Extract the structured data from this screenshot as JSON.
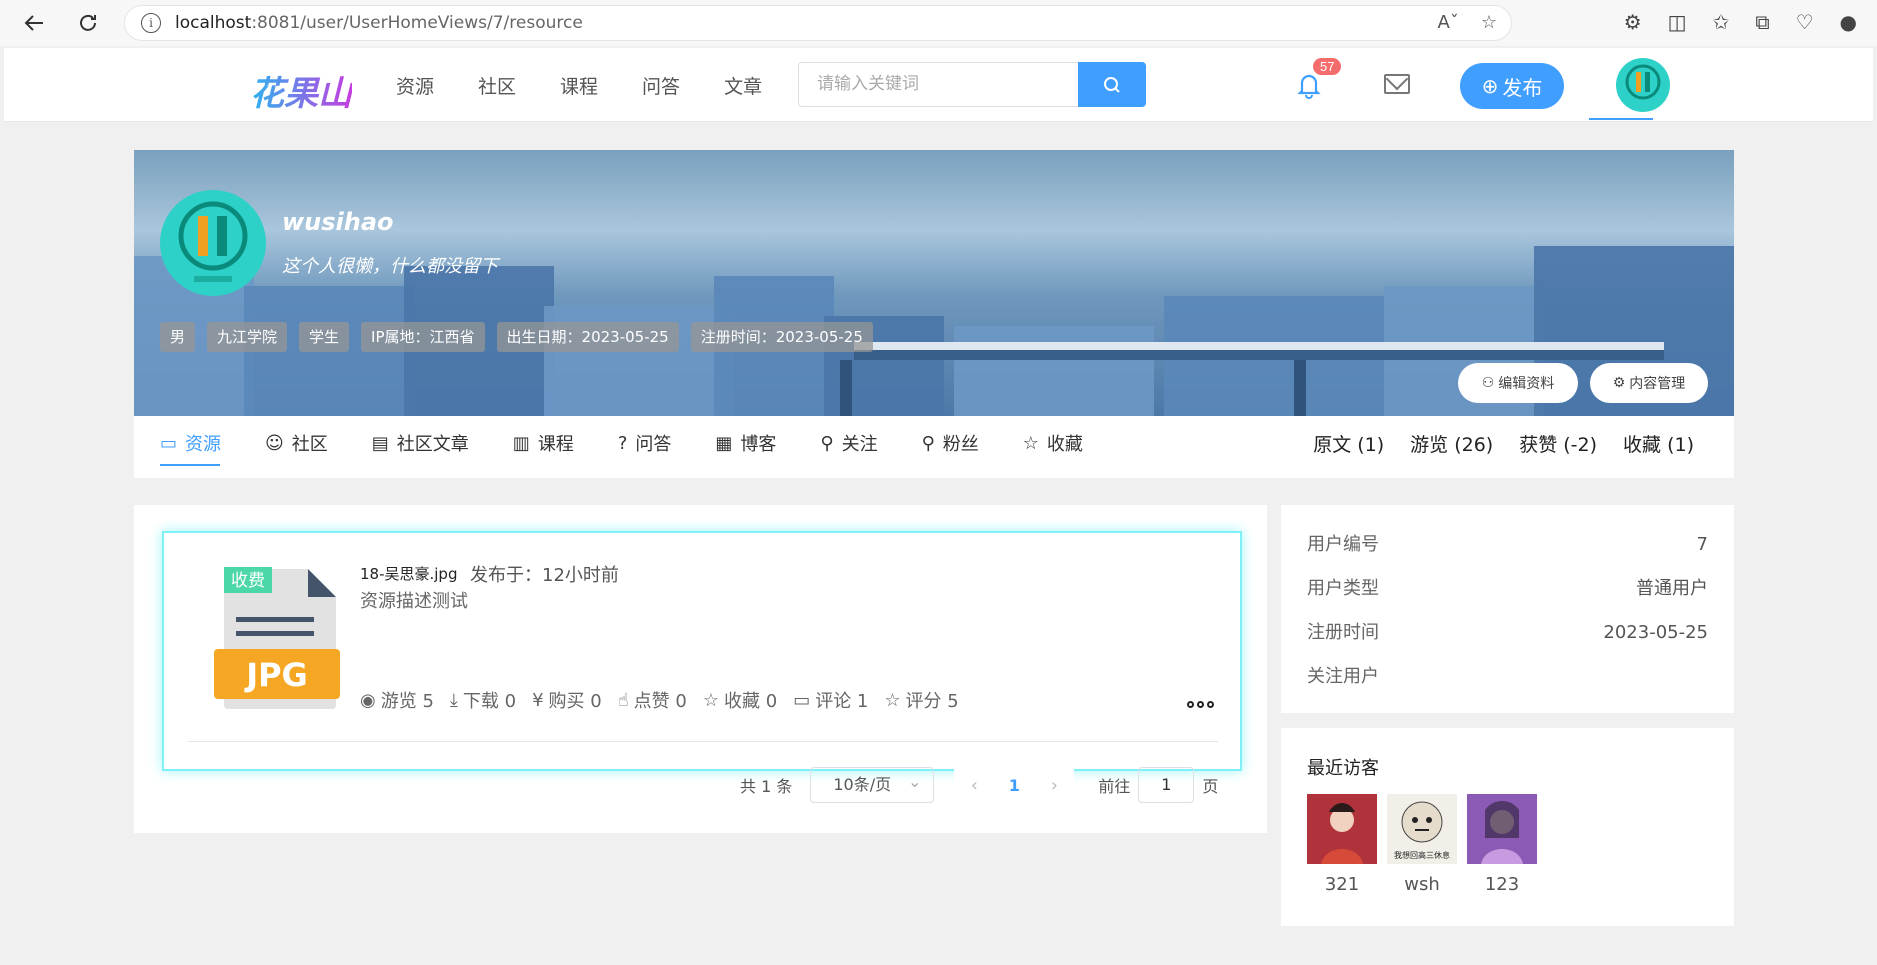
{
  "browser": {
    "url_host": "localhost",
    "url_rest": ":8081/user/UserHomeViews/7/resource"
  },
  "header": {
    "logo": "花果山",
    "nav": [
      "资源",
      "社区",
      "课程",
      "问答",
      "文章"
    ],
    "search_placeholder": "请输入关键词",
    "notification_count": "57",
    "publish_label": "发布"
  },
  "profile": {
    "username": "wusihao",
    "signature": "这个人很懒，什么都没留下",
    "tags": [
      "男",
      "九江学院",
      "学生",
      "IP属地：江西省",
      "出生日期：2023-05-25",
      "注册时间：2023-05-25"
    ],
    "edit_label": "编辑资料",
    "manage_label": "内容管理"
  },
  "tabs": [
    "资源",
    "社区",
    "社区文章",
    "课程",
    "问答",
    "博客",
    "关注",
    "粉丝",
    "收藏"
  ],
  "stats": [
    "原文 (1)",
    "游览 (26)",
    "获赞 (-2)",
    "收藏 (1)"
  ],
  "resource": {
    "badge": "收费",
    "file_type": "JPG",
    "name": "18-吴思豪.jpg",
    "published": "发布于：12小时前",
    "description": "资源描述测试",
    "meta": [
      "游览 5",
      "下载 0",
      "购买 0",
      "点赞 0",
      "收藏 0",
      "评论 1",
      "评分 5"
    ]
  },
  "pagination": {
    "total": "共 1 条",
    "page_size": "10条/页",
    "current": "1",
    "goto_label": "前往",
    "goto_value": "1",
    "page_suffix": "页"
  },
  "user_info": {
    "rows": [
      {
        "label": "用户编号",
        "value": "7"
      },
      {
        "label": "用户类型",
        "value": "普通用户"
      },
      {
        "label": "注册时间",
        "value": "2023-05-25"
      },
      {
        "label": "关注用户",
        "value": ""
      }
    ]
  },
  "visitors": {
    "title": "最近访客",
    "items": [
      {
        "name": "321",
        "color": "#b0323a"
      },
      {
        "name": "wsh",
        "color": "#e9e3d6",
        "caption": "我想回高三休息"
      },
      {
        "name": "123",
        "color": "#8a5ab5"
      }
    ]
  },
  "colors": {
    "primary": "#409eff",
    "badge_red": "#f56c6c",
    "card_glow": "#7ff0f5",
    "avatar_teal": "#2ed1c8"
  }
}
